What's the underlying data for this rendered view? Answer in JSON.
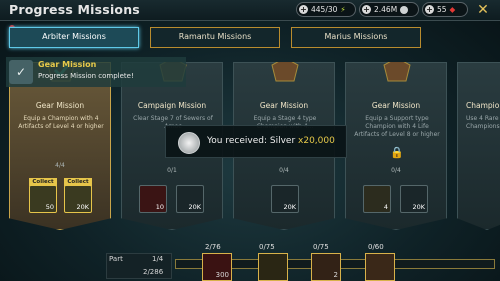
{
  "header": {
    "title": "Progress Missions",
    "close": "✕"
  },
  "resources": [
    {
      "value": "445/30",
      "icon": "lightning-icon"
    },
    {
      "value": "2.46M",
      "icon": "silver-icon"
    },
    {
      "value": "55",
      "icon": "gem-icon"
    }
  ],
  "tabs": [
    {
      "label": "Arbiter Missions",
      "active": true
    },
    {
      "label": "Ramantu Missions",
      "active": false
    },
    {
      "label": "Marius Missions",
      "active": false
    }
  ],
  "toast": {
    "title": "Gear Mission",
    "subtitle": "Progress Mission complete!"
  },
  "popup": {
    "text": "You received: Silver",
    "amount": "x20,000"
  },
  "cards": [
    {
      "name": "Gear Mission",
      "desc": "Equip a Champion with 4 Artifacts of Level 4 or higher",
      "progress": "4/4",
      "rewards": [
        {
          "label": "Collect",
          "amount": "50"
        },
        {
          "label": "Collect",
          "amount": "20K"
        }
      ]
    },
    {
      "name": "Campaign Mission",
      "desc": "Clear Stage 7 of Sewers of Arnoc",
      "progress": "0/1",
      "rewards": [
        {
          "amount": "10"
        },
        {
          "amount": "20K"
        }
      ]
    },
    {
      "name": "Gear Mission",
      "desc": "Equip a Stage 4 type Champion with 4...",
      "progress": "0/4",
      "rewards": [
        {
          "amount": "20K"
        }
      ]
    },
    {
      "name": "Gear Mission",
      "desc": "Equip a Support type Champion with 4 Life Artifacts of Level 8 or higher",
      "progress": "0/4",
      "rewards": [
        {
          "amount": "4"
        },
        {
          "amount": "20K"
        }
      ]
    },
    {
      "name": "Champion",
      "desc": "Use 4 Rare Champions",
      "progress": "",
      "rewards": []
    }
  ],
  "bottom": {
    "part_label": "Part",
    "part_value": "1/4",
    "total": "2/286"
  },
  "milestones": [
    {
      "count": "2/76",
      "amount": "300"
    },
    {
      "count": "0/75",
      "amount": ""
    },
    {
      "count": "0/75",
      "amount": "2"
    },
    {
      "count": "0/60",
      "amount": ""
    }
  ],
  "colors": {
    "accent": "#5fc9e8",
    "gold": "#e6c94a"
  }
}
